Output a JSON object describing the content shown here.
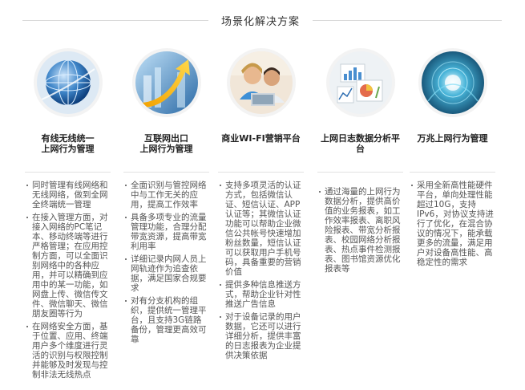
{
  "section": {
    "title": "场景化解决方案"
  },
  "columns": [
    {
      "icon": "globe-network-icon",
      "title_lines": [
        "有线无线统一",
        "上网行为管理"
      ],
      "features": [
        "同时管理有线网络和无线网络，做到全网全终端统一管理",
        "在接入管理方面，对接入网络的PC笔记本、移动终端等进行严格管理；在应用控制方面，可以全面识别网络中的各种应用，并可以精确到应用中的某一功能，如网盘上传、微信传文件、微信聊天、微信朋友圈等行为",
        "在网络安全方面，基于位置、应用、终端用户多个维度进行灵活的识别与权限控制并能够及时发现与控制非法无线热点"
      ]
    },
    {
      "icon": "internet-export-arrow-icon",
      "title_lines": [
        "互联网出口",
        "上网行为管理"
      ],
      "features": [
        "全面识别与管控网络中与工作无关的应用，提高工作效率",
        "具备多项专业的流量管理功能，合理分配带宽资源，提高带宽利用率",
        "详细记录内网人员上网轨迹作为追查依据，满足国家合规要求",
        "对有分支机构的组织，提供统一管理平台，且支持3G链路备份，管理更高效可靠"
      ]
    },
    {
      "icon": "people-laptop-icon",
      "title_lines": [
        "商业WI-FI营销平台"
      ],
      "features": [
        "支持多项灵活的认证方式，包括微信认证、短信认证、APP认证等；其微信认证功能可以帮助企业微信公共帐号快速增加粉丝数量，短信认证可以获取用户手机号码，具备重要的营销价值",
        "提供多种信息推送方式，帮助企业针对性推送广告信息",
        "对于设备记录的用户数据，它还可以进行详细分析，提供丰富的日志报表为企业提供决策依据"
      ]
    },
    {
      "icon": "report-charts-icon",
      "title_lines": [
        "上网日志数据分析平",
        "台"
      ],
      "features": [
        "通过海量的上网行为数据分析，提供高价值的业务报表，如工作效率报表、离职风险报表、带宽分析报表、校园网络分析报表、热点事件检测报表、图书馆资源优化报表等"
      ]
    },
    {
      "icon": "light-tunnel-icon",
      "title_lines": [
        "万兆上网行为管理"
      ],
      "features": [
        "采用全新高性能硬件平台，单向处理性能超过10G，支持IPv6，对协议支持进行了优化，在混合协议的情况下，能承载更多的流量，满足用户对设备高性能、高稳定性的需求"
      ]
    }
  ]
}
